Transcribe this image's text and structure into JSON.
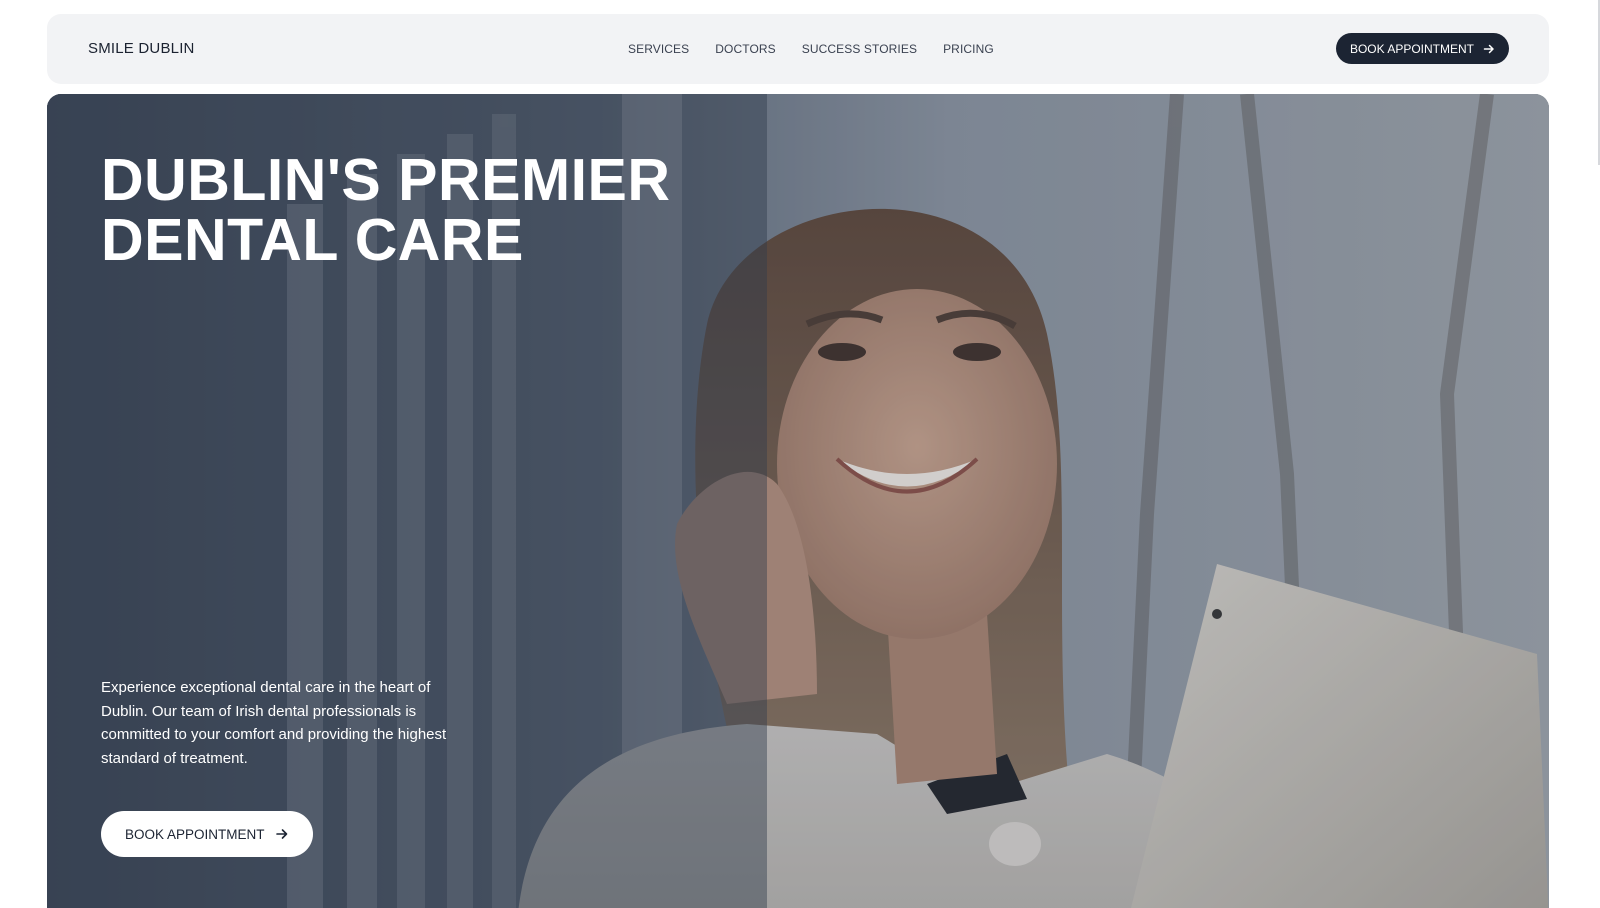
{
  "site": {
    "brand": "SMILE DUBLIN"
  },
  "nav": {
    "items": [
      {
        "label": "SERVICES"
      },
      {
        "label": "DOCTORS"
      },
      {
        "label": "SUCCESS STORIES"
      },
      {
        "label": "PRICING"
      }
    ],
    "cta_label": "BOOK APPOINTMENT",
    "cta_icon": "arrow-right-icon"
  },
  "hero": {
    "title_line1": "DUBLIN'S PREMIER",
    "title_line2": "DENTAL CARE",
    "description": "Experience exceptional dental care in the heart of Dublin. Our team of Irish dental professionals is committed to your comfort and providing the highest standard of treatment.",
    "cta_label": "BOOK APPOINTMENT",
    "cta_icon": "arrow-right-icon",
    "image_subject": "smiling woman on phone holding tablet, outdoor city background"
  },
  "colors": {
    "nav_background": "#f2f3f5",
    "primary_dark": "#1c2433",
    "text_light": "#ffffff",
    "hero_overlay": "#3f4a5c"
  }
}
